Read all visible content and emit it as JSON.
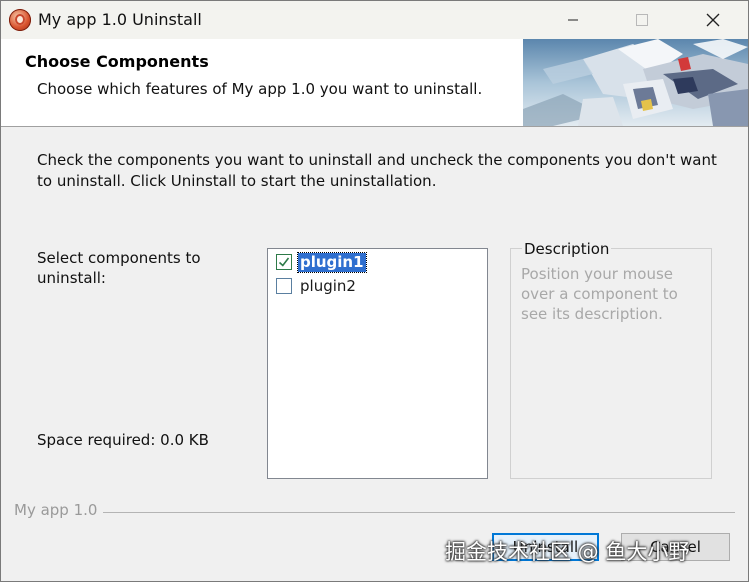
{
  "window": {
    "title": "My app 1.0 Uninstall",
    "app_icon": "installer-icon"
  },
  "titlebar_buttons": {
    "minimize_icon": "minimize-icon",
    "maximize_icon": "maximize-icon",
    "close_icon": "close-icon"
  },
  "header": {
    "title": "Choose Components",
    "subtitle": "Choose which features of My app 1.0 you want to uninstall.",
    "image": "mecha-robot-banner"
  },
  "body": {
    "instructions": "Check the components you want to uninstall and uncheck the components you don't want to uninstall. Click Uninstall to start the uninstallation.",
    "select_label": "Select components to uninstall:",
    "space_required": "Space required: 0.0 KB"
  },
  "components": [
    {
      "label": "plugin1",
      "checked": true,
      "selected": true
    },
    {
      "label": "plugin2",
      "checked": false,
      "selected": false
    }
  ],
  "description": {
    "title": "Description",
    "text": "Position your mouse over a component to see its description."
  },
  "branding": "My app 1.0",
  "buttons": {
    "uninstall": "Uninstall",
    "cancel": "Cancel"
  },
  "watermark": "掘金技术社区 @ 鱼大小野",
  "colors": {
    "selection": "#2f6fcf",
    "focus_border": "#0078d7",
    "checkmark": "#2d7a48"
  }
}
